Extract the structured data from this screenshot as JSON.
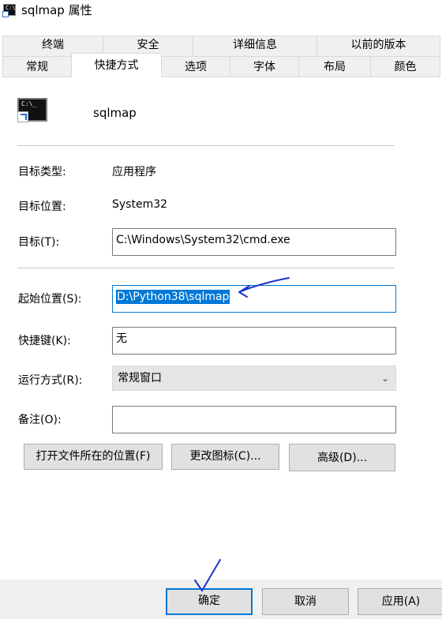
{
  "window": {
    "title": "sqlmap 属性"
  },
  "tabs_top": [
    "终端",
    "安全",
    "详细信息",
    "以前的版本"
  ],
  "tabs_bottom": [
    "常规",
    "快捷方式",
    "选项",
    "字体",
    "布局",
    "颜色"
  ],
  "shortcut": {
    "name": "sqlmap",
    "target_type_label": "目标类型:",
    "target_type": "应用程序",
    "target_location_label": "目标位置:",
    "target_location": "System32",
    "target_label": "目标(T):",
    "target": "C:\\Windows\\System32\\cmd.exe",
    "start_in_label": "起始位置(S):",
    "start_in": "D:\\Python38\\sqlmap",
    "hotkey_label": "快捷键(K):",
    "hotkey": "无",
    "run_label": "运行方式(R):",
    "run": "常规窗口",
    "comment_label": "备注(O):",
    "comment": ""
  },
  "buttons": {
    "open_location": "打开文件所在的位置(F)",
    "change_icon": "更改图标(C)...",
    "advanced": "高级(D)..."
  },
  "footer": {
    "ok": "确定",
    "cancel": "取消",
    "apply": "应用(A)"
  },
  "colors": {
    "accent": "#0078d7",
    "annotation": "#1a33cc"
  }
}
